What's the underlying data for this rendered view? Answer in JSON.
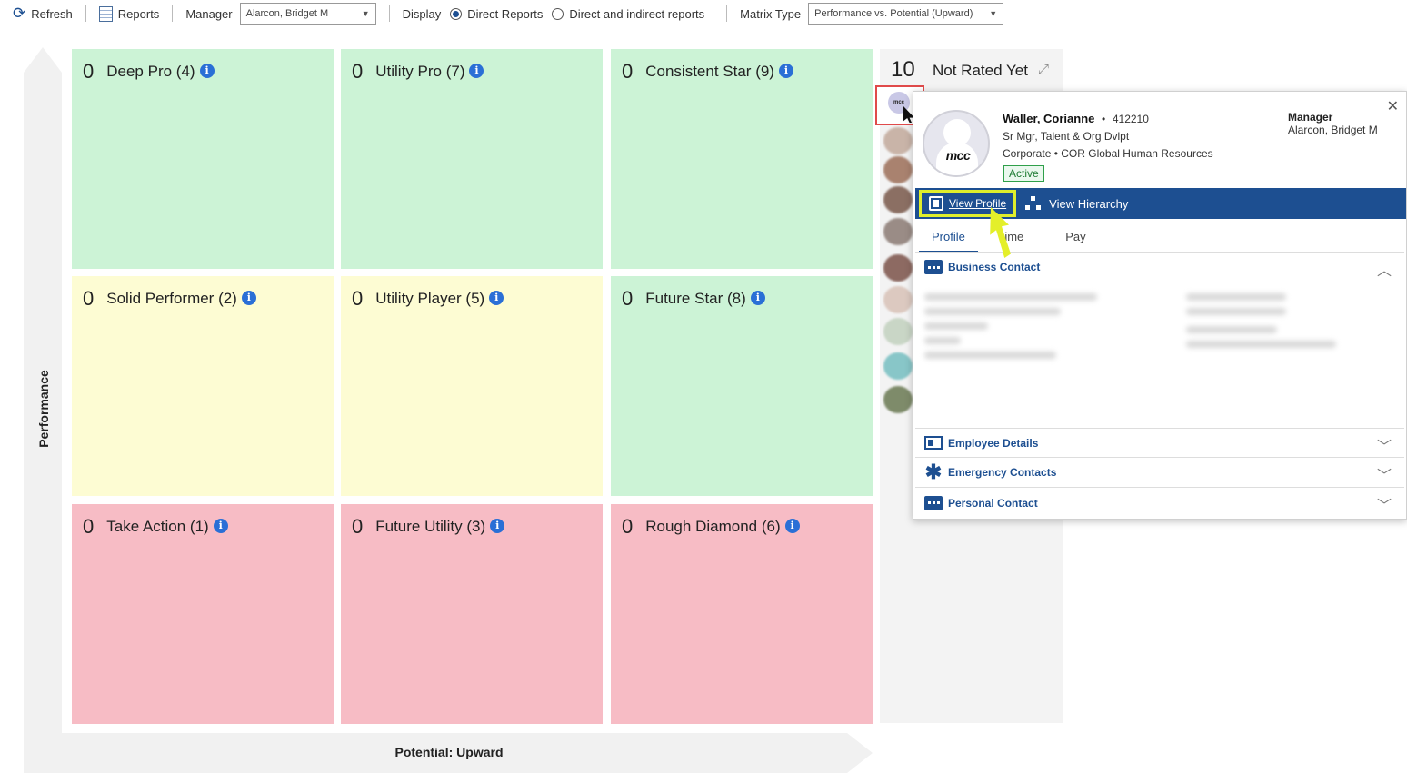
{
  "toolbar": {
    "refresh_label": "Refresh",
    "reports_label": "Reports",
    "manager_label": "Manager",
    "manager_value": "Alarcon, Bridget M",
    "display_label": "Display",
    "display_options": [
      "Direct Reports",
      "Direct and indirect reports"
    ],
    "display_selected": "Direct Reports",
    "matrix_type_label": "Matrix Type",
    "matrix_type_value": "Performance vs. Potential (Upward)"
  },
  "axes": {
    "y_label": "Performance",
    "x_label": "Potential: Upward"
  },
  "grid": [
    {
      "count": "0",
      "title": "Deep Pro (4)",
      "color": "green"
    },
    {
      "count": "0",
      "title": "Utility Pro (7)",
      "color": "green"
    },
    {
      "count": "0",
      "title": "Consistent Star (9)",
      "color": "green"
    },
    {
      "count": "0",
      "title": "Solid Performer (2)",
      "color": "yellow"
    },
    {
      "count": "0",
      "title": "Utility Player (5)",
      "color": "yellow"
    },
    {
      "count": "0",
      "title": "Future Star (8)",
      "color": "green"
    },
    {
      "count": "0",
      "title": "Take Action (1)",
      "color": "red"
    },
    {
      "count": "0",
      "title": "Future Utility (3)",
      "color": "red"
    },
    {
      "count": "0",
      "title": "Rough Diamond (6)",
      "color": "red"
    }
  ],
  "not_rated": {
    "count": "10",
    "title": "Not Rated Yet"
  },
  "popup": {
    "name": "Waller, Corianne",
    "separator": "•",
    "employee_id": "412210",
    "job_title": "Sr Mgr, Talent & Org Dvlpt",
    "org_line": "Corporate • COR Global Human Resources",
    "status": "Active",
    "manager_label": "Manager",
    "manager_name": "Alarcon, Bridget M",
    "avatar_text": "mcc",
    "actions": {
      "view_profile": "View Profile",
      "view_hierarchy": "View Hierarchy"
    },
    "tabs": [
      "Profile",
      "Time",
      "Pay"
    ],
    "active_tab": "Profile",
    "sections": [
      {
        "label": "Business Contact",
        "icon": "chat-icon",
        "expanded": true
      },
      {
        "label": "Employee Details",
        "icon": "id-card-icon",
        "expanded": false
      },
      {
        "label": "Emergency Contacts",
        "icon": "asterisk-icon",
        "expanded": false
      },
      {
        "label": "Personal Contact",
        "icon": "chat-icon",
        "expanded": false
      }
    ]
  },
  "colors": {
    "green": "#ccf3d6",
    "yellow": "#fdfcd3",
    "red": "#f7bcc5",
    "brand_blue": "#1d4f91",
    "highlight_yellow": "#dfee2c",
    "selection_red": "#e04a4a"
  }
}
